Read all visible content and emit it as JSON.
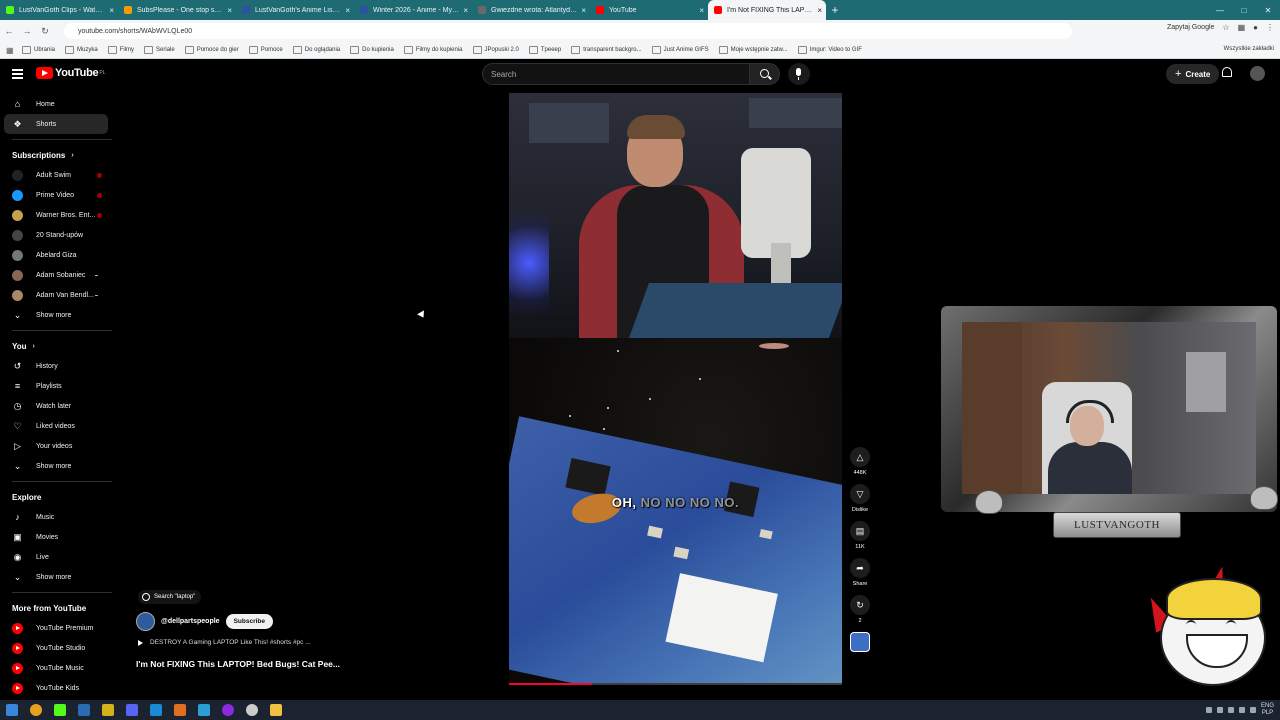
{
  "browser": {
    "tabs": [
      {
        "label": "LustVanGoth Clips - Watch Liv",
        "color": "#53fc18"
      },
      {
        "label": "SubsPlease - One stop shop fo",
        "color": "#ff9900"
      },
      {
        "label": "LustVanGoth's Anime List - My",
        "color": "#2e51a2"
      },
      {
        "label": "Winter 2026 - Anime - MyAnim",
        "color": "#2e51a2"
      },
      {
        "label": "Gwiezdne wrota: Atlantyda / St",
        "color": "#6a6a6a"
      },
      {
        "label": "YouTube",
        "color": "#ff0000"
      },
      {
        "label": "I'm Not FIXING This LAPTO",
        "color": "#ff0000"
      }
    ],
    "url": "youtube.com/shorts/WAbWVLQLe00",
    "address_right": "Zapytaj Google",
    "bookmarks": [
      "Ubrania",
      "Muzyka",
      "Filmy",
      "Seriale",
      "Pomoce do gier",
      "Pomoce",
      "Do oglądania",
      "Do kupienia",
      "Filmy do kupienia",
      "JPopuski 2.0",
      "Tpeeep",
      "transparent backgro...",
      "Just Anime GIFS",
      "Moje wstępnie zatw...",
      "Imgur: Video to GIF"
    ],
    "bookmarks_right": "Wszystkie zakładki"
  },
  "youtube": {
    "logo": "YouTube",
    "region": "PL",
    "search_placeholder": "Search",
    "create_label": "Create",
    "sidebar": {
      "main": [
        {
          "label": "Home",
          "icon": "home-icon"
        },
        {
          "label": "Shorts",
          "icon": "shorts-icon"
        }
      ],
      "subscriptions_title": "Subscriptions",
      "subscriptions": [
        {
          "label": "Adult Swim",
          "color": "#222222"
        },
        {
          "label": "Prime Video",
          "color": "#1a98ff"
        },
        {
          "label": "Warner Bros. Ent...",
          "color": "#c8a14b"
        },
        {
          "label": "20 Stand-upów",
          "color": "#444444"
        },
        {
          "label": "Abelard Giza",
          "color": "#777777"
        },
        {
          "label": "Adam Sobaniec",
          "color": "#886655"
        },
        {
          "label": "Adam Van Bendl...",
          "color": "#aa8866"
        }
      ],
      "subs_show_more": "Show more",
      "you_title": "You",
      "you_items": [
        {
          "label": "History",
          "icon": "history-icon"
        },
        {
          "label": "Playlists",
          "icon": "playlists-icon"
        },
        {
          "label": "Watch later",
          "icon": "watch-later-icon"
        },
        {
          "label": "Liked videos",
          "icon": "liked-videos-icon"
        },
        {
          "label": "Your videos",
          "icon": "your-videos-icon"
        }
      ],
      "you_show_more": "Show more",
      "explore_title": "Explore",
      "explore_items": [
        {
          "label": "Music",
          "icon": "music-icon"
        },
        {
          "label": "Movies",
          "icon": "movies-icon"
        },
        {
          "label": "Live",
          "icon": "live-icon"
        }
      ],
      "explore_show_more": "Show more",
      "more_title": "More from YouTube",
      "more_items": [
        "YouTube Premium",
        "YouTube Studio",
        "YouTube Music",
        "YouTube Kids"
      ]
    },
    "short": {
      "search_chip": "Search \"laptop\"",
      "channel": "@dellpartspeople",
      "subscribe": "Subscribe",
      "related": "DESTROY A Gaming LAPTOP Like This! #shorts #pc ...",
      "title": "I'm Not FIXING This LAPTOP! Bed Bugs! Cat Pee...",
      "caption_bright": "OH,",
      "caption_dim": "NO NO NO NO.",
      "progress_fraction": 0.25,
      "actions": [
        {
          "icon": "like-icon",
          "label": "448K"
        },
        {
          "icon": "dislike-icon",
          "label": "Dislike"
        },
        {
          "icon": "comment-icon",
          "label": "11K"
        },
        {
          "icon": "share-icon",
          "label": "Share"
        },
        {
          "icon": "remix-icon",
          "label": "2"
        }
      ]
    }
  },
  "overlay": {
    "nameplate": "LUSTVANGOTH"
  },
  "taskbar": {
    "lang": "ENG",
    "region": "PLP"
  }
}
